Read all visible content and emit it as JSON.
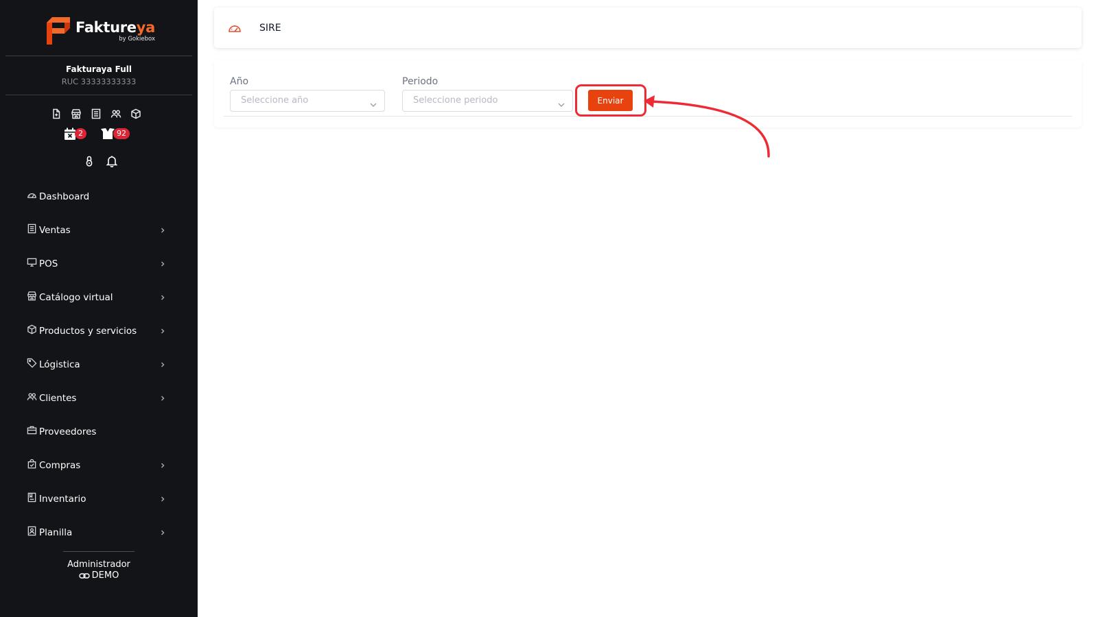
{
  "brand": {
    "name_main": "Fakture",
    "name_accent": "ya",
    "byline": "by Gokiebox",
    "colors": {
      "accent": "#f26a2a",
      "primary_button": "#e8430f",
      "badge": "#dc2637",
      "sidebar_bg": "#121418",
      "highlight": "#ee2b35"
    }
  },
  "company": {
    "name": "Fakturaya Full",
    "ruc": "RUC 33333333333"
  },
  "quick_icons": [
    "file-plus-icon",
    "store-icon",
    "receipt-icon",
    "users-icon",
    "box-icon"
  ],
  "badges": {
    "calendar_count": "2",
    "packages_count": "92"
  },
  "nav": {
    "items": [
      {
        "label": "Dashboard",
        "icon": "gauge-icon",
        "has_children": false
      },
      {
        "label": "Ventas",
        "icon": "receipt-icon",
        "has_children": true
      },
      {
        "label": "POS",
        "icon": "monitor-icon",
        "has_children": true
      },
      {
        "label": "Catálogo virtual",
        "icon": "store-icon",
        "has_children": true
      },
      {
        "label": "Productos y servicios",
        "icon": "box-icon",
        "has_children": true
      },
      {
        "label": "Lógistica",
        "icon": "tag-icon",
        "has_children": true
      },
      {
        "label": "Clientes",
        "icon": "users-icon",
        "has_children": true
      },
      {
        "label": "Proveedores",
        "icon": "briefcase-icon",
        "has_children": false
      },
      {
        "label": "Compras",
        "icon": "bag-check-icon",
        "has_children": true
      },
      {
        "label": "Inventario",
        "icon": "book-icon",
        "has_children": true
      },
      {
        "label": "Planilla",
        "icon": "id-card-icon",
        "has_children": true
      }
    ]
  },
  "footer": {
    "role": "Administrador",
    "mode": "DEMO"
  },
  "header": {
    "title": "SIRE"
  },
  "form": {
    "year_label": "Año",
    "year_placeholder": "Seleccione año",
    "period_label": "Periodo",
    "period_placeholder": "Seleccione periodo",
    "submit_label": "Enviar"
  }
}
